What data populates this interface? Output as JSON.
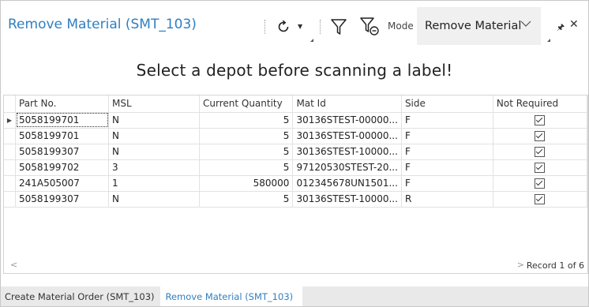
{
  "header": {
    "title": "Remove Material (SMT_103)",
    "refresh_icon": "refresh-icon",
    "filter_icon": "filter-icon",
    "clear_filter_icon": "clear-filter-icon",
    "mode_label": "Mode",
    "mode_value": "Remove Material",
    "pin_icon": "pin-icon",
    "close_icon": "close-icon"
  },
  "message": "Select a depot before scanning a label!",
  "grid": {
    "columns": [
      "Part No.",
      "MSL",
      "Current Quantity",
      "Mat Id",
      "Side",
      "Not Required"
    ],
    "rows": [
      {
        "part_no": "5058199701",
        "msl": "N",
        "qty": "5",
        "mat_id": "30136STEST-00000...",
        "side": "F",
        "not_required": true
      },
      {
        "part_no": "5058199701",
        "msl": "N",
        "qty": "5",
        "mat_id": "30136STEST-00000...",
        "side": "F",
        "not_required": true
      },
      {
        "part_no": "5058199307",
        "msl": "N",
        "qty": "5",
        "mat_id": "30136STEST-10000...",
        "side": "F",
        "not_required": true
      },
      {
        "part_no": "5058199702",
        "msl": "3",
        "qty": "5",
        "mat_id": "97120530STEST-20...",
        "side": "F",
        "not_required": true
      },
      {
        "part_no": "241A505007",
        "msl": "1",
        "qty": "580000",
        "mat_id": "012345678UN1501...",
        "side": "F",
        "not_required": true
      },
      {
        "part_no": "5058199307",
        "msl": "N",
        "qty": "5",
        "mat_id": "30136STEST-10000...",
        "side": "R",
        "not_required": true
      }
    ],
    "current_row_indicator": "▶",
    "record_label": "Record 1 of 6"
  },
  "tabs": [
    {
      "label": "Create Material Order (SMT_103)",
      "active": false
    },
    {
      "label": "Remove Material (SMT_103)",
      "active": true
    }
  ],
  "colors": {
    "accent": "#2f7fc1",
    "tab_bar": "#e9e9e9",
    "mode_bg": "#f0f0f0"
  }
}
